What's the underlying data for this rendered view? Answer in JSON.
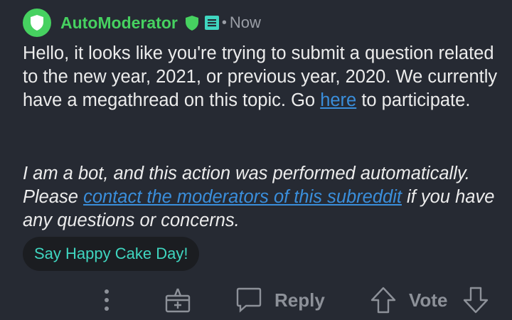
{
  "comment": {
    "author": "AutoModerator",
    "separator": "•",
    "time": "Now",
    "body_line1": "Hello, it looks like you're trying to submit a question related to the new year, 2021, or previous year, 2020. We currently have a megathread on this topic.  Go",
    "body_link": "here",
    "body_line2": " to participate.",
    "italic_start": "I am a bot, and this action was performed automatically. Please ",
    "italic_link": "contact the moderators of this subreddit",
    "italic_end": " if you have any questions or concerns."
  },
  "cake_day": {
    "label": "Say Happy Cake Day!"
  },
  "actions": {
    "reply_label": "Reply",
    "vote_label": "Vote"
  },
  "colors": {
    "accent": "#46d160",
    "link": "#3a8edb",
    "cake": "#3fd6c0",
    "background": "#262a33"
  },
  "icons": [
    "shield-icon",
    "moderator-shield-icon",
    "flair-icon",
    "more-options-icon",
    "award-icon",
    "comment-icon",
    "upvote-icon",
    "downvote-icon"
  ]
}
